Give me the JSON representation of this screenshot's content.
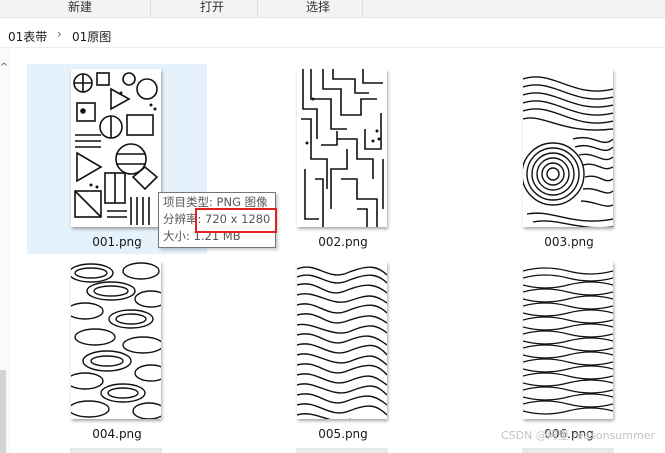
{
  "toolbar": {
    "new_label": "新建",
    "open_label": "打开",
    "select_label": "选择"
  },
  "breadcrumb": {
    "items": [
      "01表带",
      "01原图"
    ],
    "separator": "›"
  },
  "files": [
    {
      "name": "001.png",
      "pattern": "geometric",
      "selected": true
    },
    {
      "name": "002.png",
      "pattern": "circuit",
      "selected": false
    },
    {
      "name": "003.png",
      "pattern": "swirl",
      "selected": false
    },
    {
      "name": "004.png",
      "pattern": "ovals",
      "selected": false
    },
    {
      "name": "005.png",
      "pattern": "maze",
      "selected": false
    },
    {
      "name": "006.png",
      "pattern": "waves",
      "selected": false
    }
  ],
  "tooltip": {
    "type_row": "项目类型: PNG 图像",
    "resolution_row": "分辨率: 720 x 1280",
    "size_row": "大小: 1.21 MB"
  },
  "watermark": "CSDN @阿里 reasonsummer",
  "colors": {
    "selection_bg": "#e5f1fb",
    "highlight_border": "#e32020"
  }
}
